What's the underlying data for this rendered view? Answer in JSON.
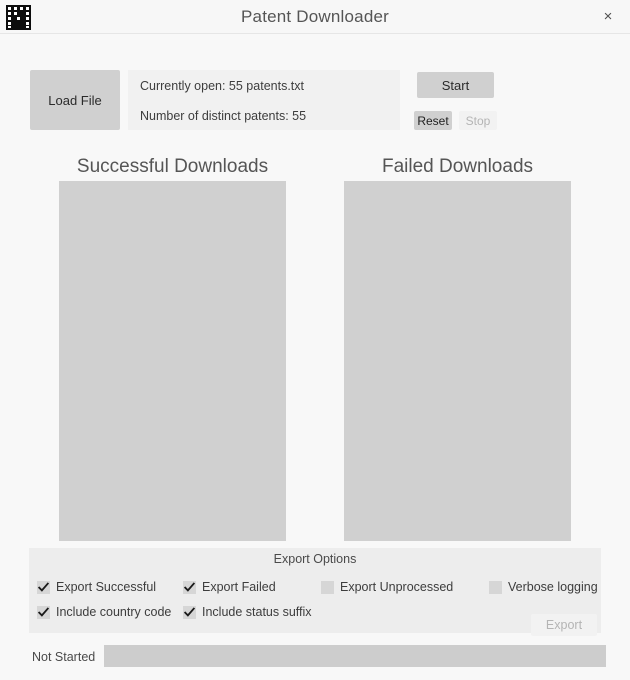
{
  "window": {
    "title": "Patent Downloader",
    "icon_name": "app-logo-icon",
    "close_label": "×"
  },
  "toolbar": {
    "load_file_label": "Load File",
    "start_label": "Start",
    "reset_label": "Reset",
    "stop_label": "Stop"
  },
  "file_info": {
    "currently_open": "Currently open: 55 patents.txt",
    "distinct_count": "Number of distinct patents: 55"
  },
  "lists": {
    "successful_heading": "Successful Downloads",
    "failed_heading": "Failed Downloads",
    "successful_items": [],
    "failed_items": []
  },
  "export_options": {
    "title": "Export Options",
    "checkboxes": [
      {
        "label": "Export Successful",
        "checked": true
      },
      {
        "label": "Export Failed",
        "checked": true
      },
      {
        "label": "Export Unprocessed",
        "checked": false
      },
      {
        "label": "Verbose logging",
        "checked": false
      },
      {
        "label": "Include country code",
        "checked": true
      },
      {
        "label": "Include status suffix",
        "checked": true
      }
    ],
    "export_label": "Export"
  },
  "status": {
    "label": "Not Started",
    "progress_percent": 0
  },
  "colors": {
    "window_background": "#f8f8f8",
    "titlebar_background": "#f7f7f7",
    "button_enabled": "#d0d0d0",
    "button_disabled": "#f2f2f2",
    "listbox_background": "#d0d0d0",
    "panel_background": "#ededed",
    "info_panel_background": "#f1f1f1",
    "progress_track": "#cdcdcd",
    "text_primary": "#3d3d3d",
    "text_muted": "#b4b4b4"
  }
}
